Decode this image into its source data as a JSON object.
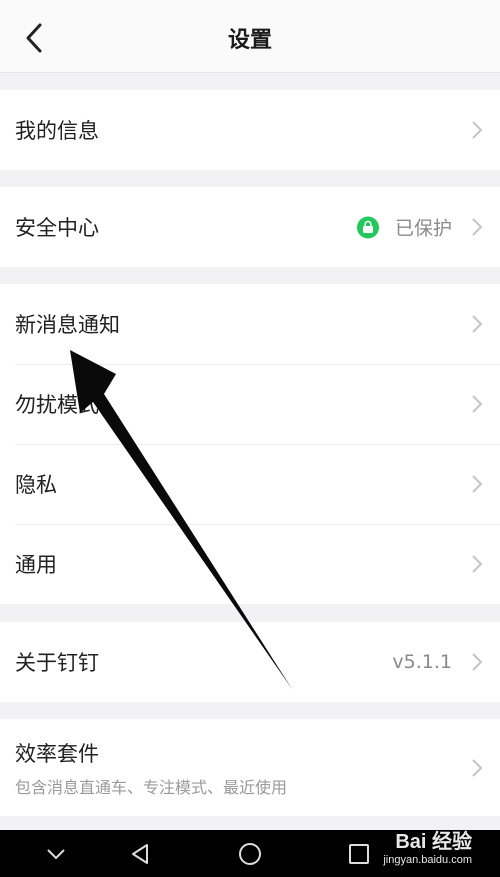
{
  "header": {
    "title": "设置",
    "back_icon": "chevron-left-icon"
  },
  "groups": [
    {
      "items": [
        {
          "label": "我的信息"
        }
      ]
    },
    {
      "items": [
        {
          "label": "安全中心",
          "value": "已保护",
          "badge_icon": "lock-icon",
          "badge_color": "#23c85a"
        }
      ]
    },
    {
      "items": [
        {
          "label": "新消息通知"
        },
        {
          "label": "勿扰模式"
        },
        {
          "label": "隐私"
        },
        {
          "label": "通用"
        }
      ]
    },
    {
      "items": [
        {
          "label": "关于钉钉",
          "value": "v5.1.1"
        }
      ]
    },
    {
      "items": [
        {
          "label": "效率套件",
          "sublabel": "包含消息直通车、专注模式、最近使用"
        }
      ]
    }
  ],
  "navbar": {
    "icons": [
      "chevron-down-icon",
      "back-triangle-icon",
      "home-circle-icon",
      "recents-square-icon"
    ]
  },
  "watermark": {
    "brand": "Bai 经验",
    "url": "jingyan.baidu.com"
  },
  "colors": {
    "accent_green": "#23c85a",
    "background": "#f2f2f4"
  }
}
